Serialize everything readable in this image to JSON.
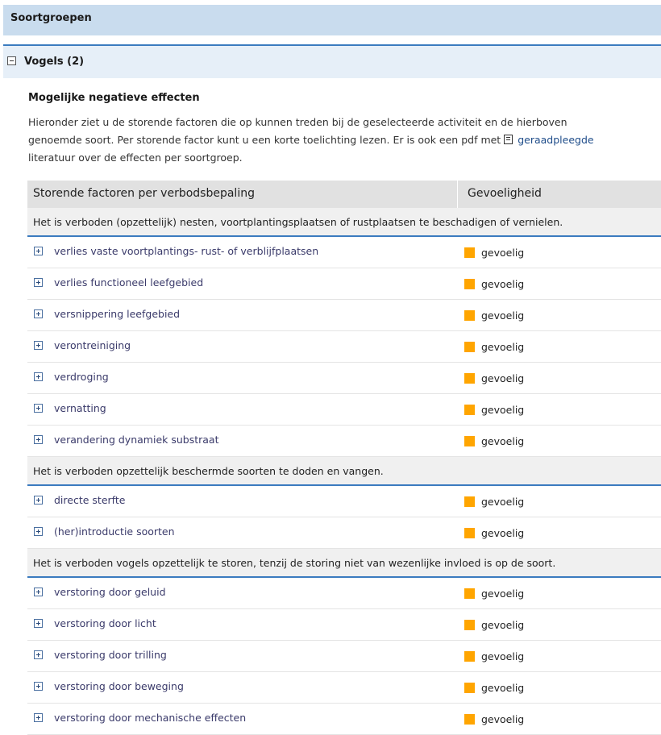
{
  "header": {
    "title": "Soortgroepen"
  },
  "group": {
    "title": "Vogels (2)"
  },
  "effects": {
    "title": "Mogelijke negatieve effecten",
    "intro_line1": "Hieronder ziet u de storende factoren die op kunnen treden bij de geselecteerde activiteit en de hierboven",
    "intro_line2_a": "genoemde soort. Per storende factor kunt u een korte toelichting lezen. Er is ook een pdf met",
    "intro_link": "geraadpleegde",
    "intro_line3": "literatuur over de effecten per soortgroep."
  },
  "table": {
    "col1": "Storende factoren per verbodsbepaling",
    "col2": "Gevoeligheid",
    "sensitivity_color": "#ffa500",
    "groups": [
      {
        "heading": "Het is verboden (opzettelijk) nesten, voortplantingsplaatsen of rustplaatsen te beschadigen of vernielen.",
        "rows": [
          {
            "factor": "verlies vaste voortplantings- rust- of verblijfplaatsen",
            "level": "gevoelig"
          },
          {
            "factor": "verlies functioneel leefgebied",
            "level": "gevoelig"
          },
          {
            "factor": "versnippering leefgebied",
            "level": "gevoelig"
          },
          {
            "factor": "verontreiniging",
            "level": "gevoelig"
          },
          {
            "factor": "verdroging",
            "level": "gevoelig"
          },
          {
            "factor": "vernatting",
            "level": "gevoelig"
          },
          {
            "factor": "verandering dynamiek substraat",
            "level": "gevoelig"
          }
        ]
      },
      {
        "heading": "Het is verboden opzettelijk beschermde soorten te doden en vangen.",
        "rows": [
          {
            "factor": "directe sterfte",
            "level": "gevoelig"
          },
          {
            "factor": "(her)introductie soorten",
            "level": "gevoelig"
          }
        ]
      },
      {
        "heading": "Het is verboden vogels opzettelijk te storen, tenzij de storing niet van wezenlijke invloed is op de soort.",
        "rows": [
          {
            "factor": "verstoring door geluid",
            "level": "gevoelig"
          },
          {
            "factor": "verstoring door licht",
            "level": "gevoelig"
          },
          {
            "factor": "verstoring door trilling",
            "level": "gevoelig"
          },
          {
            "factor": "verstoring door beweging",
            "level": "gevoelig"
          },
          {
            "factor": "verstoring door mechanische effecten",
            "level": "gevoelig"
          }
        ]
      }
    ]
  }
}
